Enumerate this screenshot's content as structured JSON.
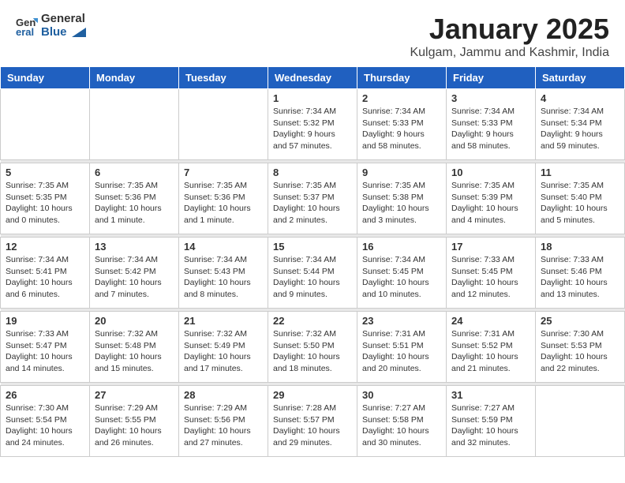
{
  "header": {
    "logo_general": "General",
    "logo_blue": "Blue",
    "month_title": "January 2025",
    "location": "Kulgam, Jammu and Kashmir, India"
  },
  "days_of_week": [
    "Sunday",
    "Monday",
    "Tuesday",
    "Wednesday",
    "Thursday",
    "Friday",
    "Saturday"
  ],
  "weeks": [
    {
      "days": [
        {
          "num": "",
          "info": ""
        },
        {
          "num": "",
          "info": ""
        },
        {
          "num": "",
          "info": ""
        },
        {
          "num": "1",
          "info": "Sunrise: 7:34 AM\nSunset: 5:32 PM\nDaylight: 9 hours\nand 57 minutes."
        },
        {
          "num": "2",
          "info": "Sunrise: 7:34 AM\nSunset: 5:33 PM\nDaylight: 9 hours\nand 58 minutes."
        },
        {
          "num": "3",
          "info": "Sunrise: 7:34 AM\nSunset: 5:33 PM\nDaylight: 9 hours\nand 58 minutes."
        },
        {
          "num": "4",
          "info": "Sunrise: 7:34 AM\nSunset: 5:34 PM\nDaylight: 9 hours\nand 59 minutes."
        }
      ]
    },
    {
      "days": [
        {
          "num": "5",
          "info": "Sunrise: 7:35 AM\nSunset: 5:35 PM\nDaylight: 10 hours\nand 0 minutes."
        },
        {
          "num": "6",
          "info": "Sunrise: 7:35 AM\nSunset: 5:36 PM\nDaylight: 10 hours\nand 1 minute."
        },
        {
          "num": "7",
          "info": "Sunrise: 7:35 AM\nSunset: 5:36 PM\nDaylight: 10 hours\nand 1 minute."
        },
        {
          "num": "8",
          "info": "Sunrise: 7:35 AM\nSunset: 5:37 PM\nDaylight: 10 hours\nand 2 minutes."
        },
        {
          "num": "9",
          "info": "Sunrise: 7:35 AM\nSunset: 5:38 PM\nDaylight: 10 hours\nand 3 minutes."
        },
        {
          "num": "10",
          "info": "Sunrise: 7:35 AM\nSunset: 5:39 PM\nDaylight: 10 hours\nand 4 minutes."
        },
        {
          "num": "11",
          "info": "Sunrise: 7:35 AM\nSunset: 5:40 PM\nDaylight: 10 hours\nand 5 minutes."
        }
      ]
    },
    {
      "days": [
        {
          "num": "12",
          "info": "Sunrise: 7:34 AM\nSunset: 5:41 PM\nDaylight: 10 hours\nand 6 minutes."
        },
        {
          "num": "13",
          "info": "Sunrise: 7:34 AM\nSunset: 5:42 PM\nDaylight: 10 hours\nand 7 minutes."
        },
        {
          "num": "14",
          "info": "Sunrise: 7:34 AM\nSunset: 5:43 PM\nDaylight: 10 hours\nand 8 minutes."
        },
        {
          "num": "15",
          "info": "Sunrise: 7:34 AM\nSunset: 5:44 PM\nDaylight: 10 hours\nand 9 minutes."
        },
        {
          "num": "16",
          "info": "Sunrise: 7:34 AM\nSunset: 5:45 PM\nDaylight: 10 hours\nand 10 minutes."
        },
        {
          "num": "17",
          "info": "Sunrise: 7:33 AM\nSunset: 5:45 PM\nDaylight: 10 hours\nand 12 minutes."
        },
        {
          "num": "18",
          "info": "Sunrise: 7:33 AM\nSunset: 5:46 PM\nDaylight: 10 hours\nand 13 minutes."
        }
      ]
    },
    {
      "days": [
        {
          "num": "19",
          "info": "Sunrise: 7:33 AM\nSunset: 5:47 PM\nDaylight: 10 hours\nand 14 minutes."
        },
        {
          "num": "20",
          "info": "Sunrise: 7:32 AM\nSunset: 5:48 PM\nDaylight: 10 hours\nand 15 minutes."
        },
        {
          "num": "21",
          "info": "Sunrise: 7:32 AM\nSunset: 5:49 PM\nDaylight: 10 hours\nand 17 minutes."
        },
        {
          "num": "22",
          "info": "Sunrise: 7:32 AM\nSunset: 5:50 PM\nDaylight: 10 hours\nand 18 minutes."
        },
        {
          "num": "23",
          "info": "Sunrise: 7:31 AM\nSunset: 5:51 PM\nDaylight: 10 hours\nand 20 minutes."
        },
        {
          "num": "24",
          "info": "Sunrise: 7:31 AM\nSunset: 5:52 PM\nDaylight: 10 hours\nand 21 minutes."
        },
        {
          "num": "25",
          "info": "Sunrise: 7:30 AM\nSunset: 5:53 PM\nDaylight: 10 hours\nand 22 minutes."
        }
      ]
    },
    {
      "days": [
        {
          "num": "26",
          "info": "Sunrise: 7:30 AM\nSunset: 5:54 PM\nDaylight: 10 hours\nand 24 minutes."
        },
        {
          "num": "27",
          "info": "Sunrise: 7:29 AM\nSunset: 5:55 PM\nDaylight: 10 hours\nand 26 minutes."
        },
        {
          "num": "28",
          "info": "Sunrise: 7:29 AM\nSunset: 5:56 PM\nDaylight: 10 hours\nand 27 minutes."
        },
        {
          "num": "29",
          "info": "Sunrise: 7:28 AM\nSunset: 5:57 PM\nDaylight: 10 hours\nand 29 minutes."
        },
        {
          "num": "30",
          "info": "Sunrise: 7:27 AM\nSunset: 5:58 PM\nDaylight: 10 hours\nand 30 minutes."
        },
        {
          "num": "31",
          "info": "Sunrise: 7:27 AM\nSunset: 5:59 PM\nDaylight: 10 hours\nand 32 minutes."
        },
        {
          "num": "",
          "info": ""
        }
      ]
    }
  ]
}
